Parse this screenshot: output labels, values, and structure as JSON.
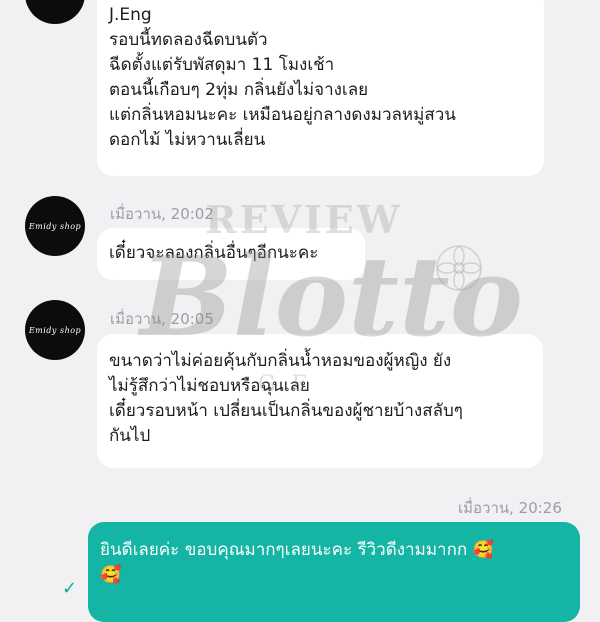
{
  "messages": [
    {
      "sender": "shop",
      "time": "",
      "lines": [
        "J.Eng",
        "รอบนี้ทดลองฉีดบนตัว",
        "ฉีดตั้งแต่รับพัสดุมา 11 โมงเช้า",
        "ตอนนี้เกือบๆ 2ทุ่ม กลิ่นยังไม่จางเลย",
        "แต่กลิ่นหอมนะคะ เหมือนอยู่กลางดงมวลหมู่สวน",
        "ดอกไม้ ไม่หวานเลี่ยน"
      ]
    },
    {
      "sender": "shop",
      "time": "เมื่อวาน, 20:02",
      "lines": [
        "เดี๋ยวจะลองกลิ่นอื่นๆอีกนะคะ"
      ]
    },
    {
      "sender": "shop",
      "time": "เมื่อวาน, 20:05",
      "lines": [
        "ขนาดว่าไม่ค่อยคุ้นกับกลิ่นน้ำหอมของผู้หญิง ยัง",
        "ไม่รู้สึกว่าไม่ชอบหรือฉุนเลย",
        "เดี๋ยวรอบหน้า เปลี่ยนเป็นกลิ่นของผู้ชายบ้างสลับๆ",
        "กันไป"
      ]
    },
    {
      "sender": "me",
      "time": "เมื่อวาน, 20:26",
      "lines": [
        "ยินดีเลยค่ะ ขอบคุณมากๆเลยนะคะ รีวิวดีงามมากก 🥰",
        "🥰"
      ],
      "read_status": "✓"
    }
  ],
  "avatar": {
    "text": "Emidy shop"
  },
  "watermark": {
    "top": "REVIEW",
    "brand": "Blotto",
    "bottom": "GE"
  },
  "colors": {
    "background": "#f1f1f3",
    "incoming_bubble": "#ffffff",
    "outgoing_bubble": "#14b5a4",
    "timestamp": "#9c9ca2",
    "avatar": "#0c0c0c"
  }
}
